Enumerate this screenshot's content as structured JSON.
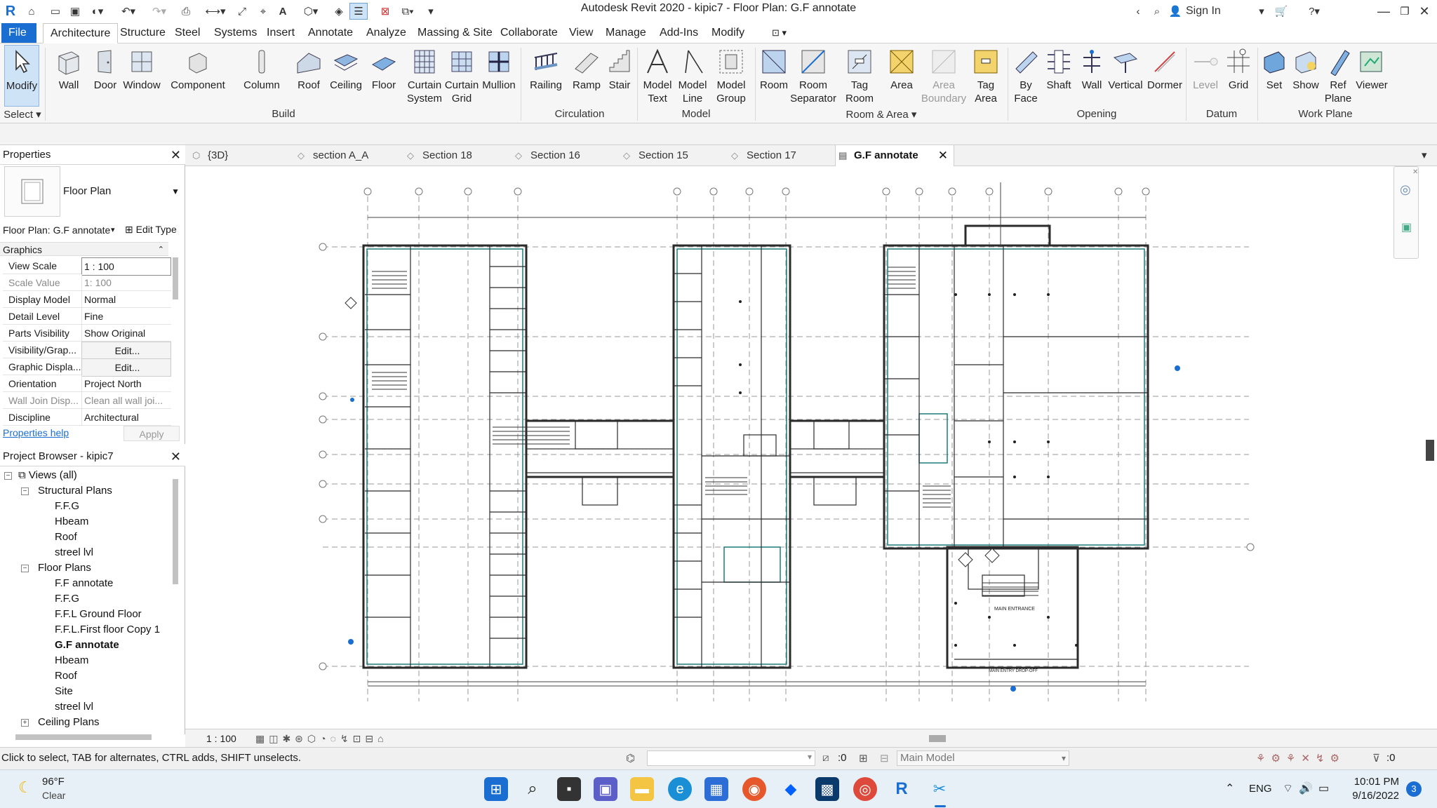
{
  "app": {
    "title": "Autodesk Revit 2020 - kipic7 - Floor Plan: G.F annotate",
    "sign_in": "Sign In"
  },
  "ribbon": {
    "tabs": [
      "File",
      "Architecture",
      "Structure",
      "Steel",
      "Systems",
      "Insert",
      "Annotate",
      "Analyze",
      "Massing & Site",
      "Collaborate",
      "View",
      "Manage",
      "Add-Ins",
      "Modify"
    ],
    "active_tab": "Architecture",
    "buttons": {
      "modify": "Modify",
      "wall": "Wall",
      "door": "Door",
      "window": "Window",
      "component": "Component",
      "column": "Column",
      "roof": "Roof",
      "ceiling": "Ceiling",
      "floor": "Floor",
      "curtain_system": "Curtain System",
      "curtain_grid": "Curtain Grid",
      "mullion": "Mullion",
      "railing": "Railing",
      "ramp": "Ramp",
      "stair": "Stair",
      "model_text": "Model Text",
      "model_line": "Model Line",
      "model_group": "Model Group",
      "room": "Room",
      "room_separator": "Room Separator",
      "tag_room": "Tag Room",
      "area": "Area",
      "area_boundary": "Area Boundary",
      "tag_area": "Tag Area",
      "by_face": "By Face",
      "shaft": "Shaft",
      "wall_opening": "Wall",
      "vertical": "Vertical",
      "dormer": "Dormer",
      "level": "Level",
      "grid": "Grid",
      "set": "Set",
      "show": "Show",
      "ref_plane": "Ref Plane",
      "viewer": "Viewer"
    },
    "panels": {
      "select": "Select",
      "build": "Build",
      "circulation": "Circulation",
      "model": "Model",
      "room_area": "Room & Area",
      "opening": "Opening",
      "datum": "Datum",
      "work_plane": "Work Plane"
    }
  },
  "view_tabs": [
    {
      "label": "{3D}"
    },
    {
      "label": "section A_A"
    },
    {
      "label": "Section 18"
    },
    {
      "label": "Section 16"
    },
    {
      "label": "Section 15"
    },
    {
      "label": "Section 17"
    },
    {
      "label": "G.F annotate",
      "active": true
    }
  ],
  "properties": {
    "header": "Properties",
    "type_name": "Floor Plan",
    "instance_selector": "Floor Plan: G.F annotate",
    "edit_type": "Edit Type",
    "group": "Graphics",
    "rows": [
      {
        "key": "View Scale",
        "value": "1 : 100"
      },
      {
        "key": "Scale Value",
        "prefix": "1:",
        "value": "100",
        "dim": true
      },
      {
        "key": "Display Model",
        "value": "Normal"
      },
      {
        "key": "Detail Level",
        "value": "Fine"
      },
      {
        "key": "Parts Visibility",
        "value": "Show Original"
      },
      {
        "key": "Visibility/Grap...",
        "value": "Edit..."
      },
      {
        "key": "Graphic Displa...",
        "value": "Edit..."
      },
      {
        "key": "Orientation",
        "value": "Project North"
      },
      {
        "key": "Wall Join Disp...",
        "value": "Clean all wall joi...",
        "dim": true
      },
      {
        "key": "Discipline",
        "value": "Architectural"
      }
    ],
    "help_link": "Properties help",
    "apply": "Apply"
  },
  "browser": {
    "header": "Project Browser - kipic7",
    "root": "Views (all)",
    "structural_plans": {
      "label": "Structural Plans",
      "items": [
        "F.F.G",
        "Hbeam",
        "Roof",
        "streel lvl"
      ]
    },
    "floor_plans": {
      "label": "Floor Plans",
      "items": [
        "F.F annotate",
        "F.F.G",
        "F.F.L Ground Floor",
        "F.F.L.First floor Copy 1",
        "G.F annotate",
        "Hbeam",
        "Roof",
        "Site",
        "streel lvl"
      ],
      "selected": "G.F annotate"
    },
    "ceiling_plans": {
      "label": "Ceiling Plans"
    }
  },
  "drawing": {
    "main_entrance": "MAIN ENTRANCE",
    "drop_off": "MAIN ENTRY DROP-OFF"
  },
  "view_control": {
    "scale": "1 : 100"
  },
  "status": {
    "hint": "Click to select, TAB for alternates, CTRL adds, SHIFT unselects.",
    "selection_count": ":0",
    "model": "Main Model",
    "filter_count": ":0"
  },
  "taskbar": {
    "weather_temp": "96°F",
    "weather_desc": "Clear",
    "lang": "ENG",
    "time": "10:01 PM",
    "date": "9/16/2022",
    "notifications": "3"
  },
  "colors": {
    "accent": "#1b6ed1",
    "drawing_line": "#2b2b2b",
    "teal": "#1e7a7a"
  }
}
